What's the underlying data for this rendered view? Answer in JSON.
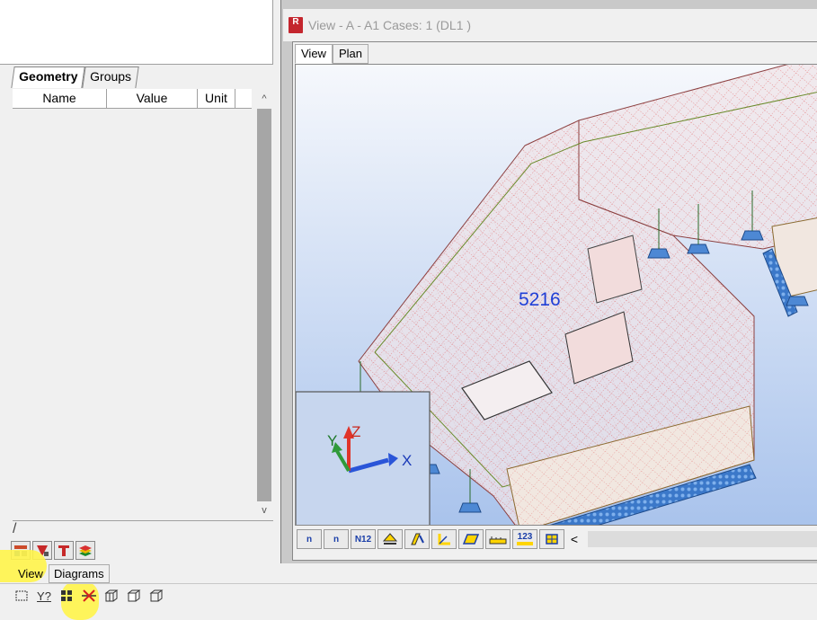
{
  "properties_panel": {
    "tabs": [
      {
        "label": "Geometry",
        "active": true
      },
      {
        "label": "Groups",
        "active": false
      }
    ],
    "columns": [
      "Name",
      "Value",
      "Unit"
    ],
    "scroll_up": "^",
    "scroll_down": "v",
    "bottom_tab_slash": "/"
  },
  "mini_toolbar": {
    "icons": [
      "structure-tree-icon",
      "red-panel-icon",
      "section-icon",
      "layers-icon"
    ]
  },
  "bottom_tabs": [
    {
      "label": "View",
      "active": true
    },
    {
      "label": "Diagrams",
      "active": false
    }
  ],
  "bottom_tools": {
    "icons": [
      "select-region-icon",
      "query-icon",
      "grid-icon",
      "cross-out-icon",
      "box-iso-icon",
      "box-front-icon",
      "box-wire-icon"
    ],
    "query_label": "Y?"
  },
  "view_window": {
    "app_icon_label": "R",
    "title": "View -  A - A1 Cases: 1 (DL1 )",
    "tabs": [
      {
        "label": "View",
        "active": true
      },
      {
        "label": "Plan",
        "active": false
      }
    ],
    "model_label": "5216",
    "axes": {
      "x": "X",
      "y": "Y",
      "z": "Z"
    },
    "toolbar": [
      {
        "icon": "node-numbers-icon",
        "label": "n"
      },
      {
        "icon": "node-icon",
        "label": "n"
      },
      {
        "icon": "n12-icon",
        "label": "N12"
      },
      {
        "icon": "slab-support-icon",
        "label": ""
      },
      {
        "icon": "load-icon",
        "label": ""
      },
      {
        "icon": "bar-icon",
        "label": ""
      },
      {
        "icon": "panel-icon",
        "label": ""
      },
      {
        "icon": "dimension-icon",
        "label": ""
      },
      {
        "icon": "numbering-icon",
        "label": "123"
      },
      {
        "icon": "refresh-icon",
        "label": ""
      }
    ],
    "scroll_left": "<"
  },
  "colors": {
    "canvas_top": "#f6f8fc",
    "canvas_bottom": "#a9c3ec",
    "mesh_red": "#e05050",
    "support_blue": "#3b78c9",
    "label_blue": "#1f3fd6",
    "highlight": "#fff44a"
  }
}
